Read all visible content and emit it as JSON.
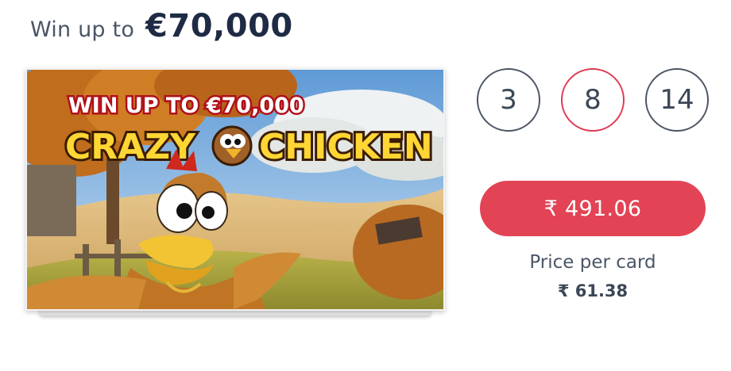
{
  "header": {
    "lead_text": "Win up to",
    "amount": "€70,000"
  },
  "game_card": {
    "banner_line1": "WIN UP TO €70,000",
    "banner_line2_part1": "CRAZY",
    "banner_line2_part2": "CHICKEN"
  },
  "card_picker": {
    "options": [
      "3",
      "8",
      "14"
    ],
    "selected": "8"
  },
  "buy_button": {
    "label": "₹ 491.06"
  },
  "price": {
    "label": "Price per card",
    "value": "₹ 61.38"
  },
  "colors": {
    "accent": "#e24456",
    "selected_border": "#e03a50",
    "text_dark": "#1f2a44",
    "text_body": "#3b4656"
  }
}
